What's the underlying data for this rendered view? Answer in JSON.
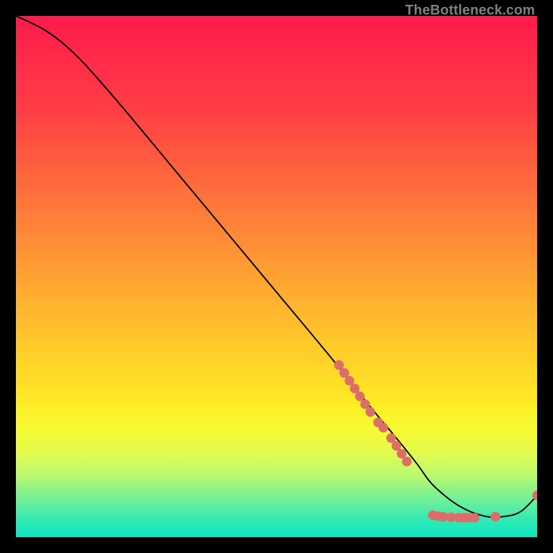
{
  "attribution": "TheBottleneck.com",
  "chart_data": {
    "type": "line",
    "title": "",
    "xlabel": "",
    "ylabel": "",
    "xlim": [
      0,
      100
    ],
    "ylim": [
      0,
      100
    ],
    "grid": false,
    "gradient_stops": [
      {
        "offset": 0,
        "color": "#ff1a4c"
      },
      {
        "offset": 18,
        "color": "#ff3e45"
      },
      {
        "offset": 38,
        "color": "#ff7c39"
      },
      {
        "offset": 55,
        "color": "#ffb22f"
      },
      {
        "offset": 72,
        "color": "#ffe326"
      },
      {
        "offset": 76,
        "color": "#fbf227"
      },
      {
        "offset": 80,
        "color": "#f5fa35"
      },
      {
        "offset": 84,
        "color": "#e1fb4f"
      },
      {
        "offset": 88,
        "color": "#bdf96e"
      },
      {
        "offset": 91,
        "color": "#8ef388"
      },
      {
        "offset": 94,
        "color": "#5deea0"
      },
      {
        "offset": 97,
        "color": "#2ee9b4"
      },
      {
        "offset": 100,
        "color": "#0fe6c4"
      }
    ],
    "series": [
      {
        "name": "bottleneck-curve",
        "x": [
          0,
          6,
          12,
          20,
          30,
          40,
          50,
          60,
          68,
          73,
          77,
          80,
          85,
          90,
          94,
          97,
          100
        ],
        "y": [
          100,
          97,
          92,
          83,
          71,
          59,
          47,
          35,
          25,
          19,
          14,
          10,
          6,
          4,
          4,
          5,
          8
        ]
      }
    ],
    "markers": {
      "name": "highlight-dots",
      "color": "#dc6e6a",
      "radius": 7,
      "points": [
        {
          "x": 62,
          "y": 33
        },
        {
          "x": 63,
          "y": 31.5
        },
        {
          "x": 64,
          "y": 30
        },
        {
          "x": 65,
          "y": 28.5
        },
        {
          "x": 66,
          "y": 27
        },
        {
          "x": 67,
          "y": 25.5
        },
        {
          "x": 68,
          "y": 24
        },
        {
          "x": 69.5,
          "y": 22
        },
        {
          "x": 70.5,
          "y": 21
        },
        {
          "x": 72,
          "y": 19
        },
        {
          "x": 73,
          "y": 17.5
        },
        {
          "x": 74,
          "y": 16
        },
        {
          "x": 75,
          "y": 14.5
        },
        {
          "x": 80,
          "y": 4.2
        },
        {
          "x": 81,
          "y": 4.0
        },
        {
          "x": 82,
          "y": 3.9
        },
        {
          "x": 83.5,
          "y": 3.8
        },
        {
          "x": 85,
          "y": 3.7
        },
        {
          "x": 86,
          "y": 3.7
        },
        {
          "x": 87,
          "y": 3.7
        },
        {
          "x": 88,
          "y": 3.7
        },
        {
          "x": 92,
          "y": 3.9
        },
        {
          "x": 100,
          "y": 8
        }
      ]
    }
  }
}
